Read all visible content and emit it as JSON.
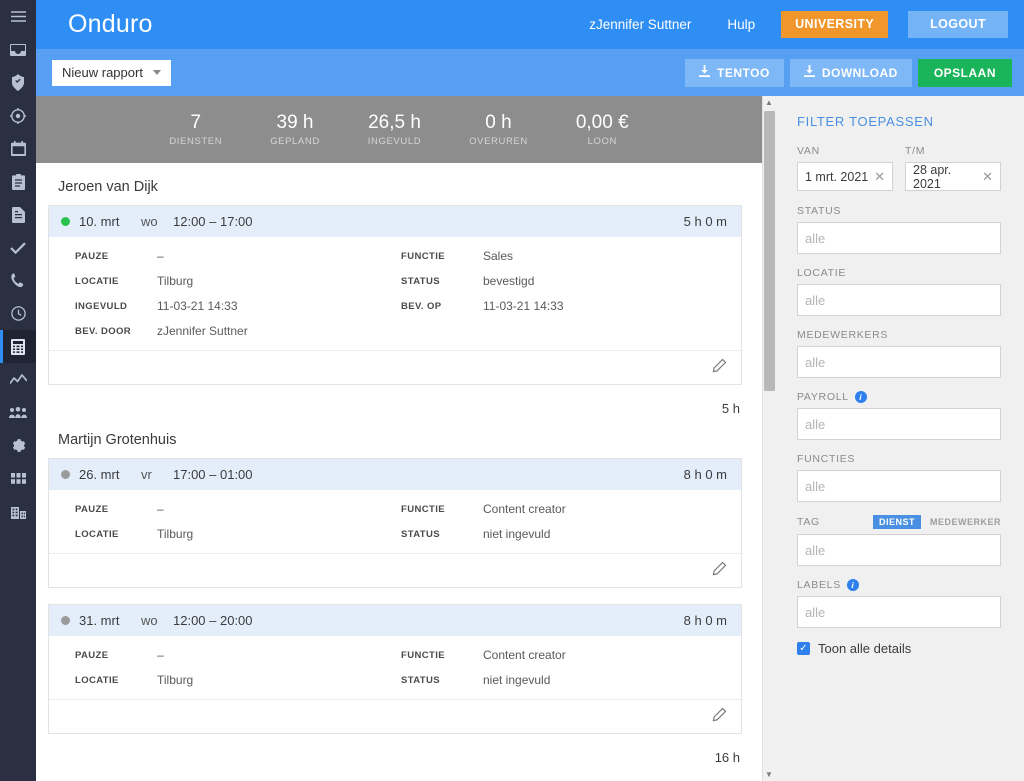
{
  "rail": {
    "items": [
      {
        "icon": "menu-icon",
        "name": "menu"
      },
      {
        "icon": "inbox-icon",
        "name": "inbox"
      },
      {
        "icon": "shield-check-icon",
        "name": "availability"
      },
      {
        "icon": "target-icon",
        "name": "clock-in"
      },
      {
        "icon": "calendar-icon",
        "name": "schedule"
      },
      {
        "icon": "clipboard-icon",
        "name": "tasks"
      },
      {
        "icon": "document-icon",
        "name": "documents"
      },
      {
        "icon": "check-icon",
        "name": "approvals"
      },
      {
        "icon": "phone-icon",
        "name": "contacts"
      },
      {
        "icon": "clock-icon",
        "name": "timeclock"
      },
      {
        "icon": "calculator-icon",
        "name": "reports",
        "active": true
      },
      {
        "icon": "chart-line-icon",
        "name": "analytics"
      },
      {
        "icon": "people-icon",
        "name": "employees"
      },
      {
        "icon": "gear-icon",
        "name": "settings"
      },
      {
        "icon": "grid-icon",
        "name": "apps"
      },
      {
        "icon": "building-icon",
        "name": "organisation"
      }
    ]
  },
  "header": {
    "brand": "Onduro",
    "user": "zJennifer Suttner",
    "help": "Hulp",
    "university": "UNIVERSITY",
    "logout": "LOGOUT"
  },
  "toolbar": {
    "report_select": "Nieuw rapport",
    "tentoo": "TENTOO",
    "download": "DOWNLOAD",
    "save": "OPSLAAN"
  },
  "stats": [
    {
      "value": "7",
      "label": "DIENSTEN"
    },
    {
      "value": "39 h",
      "label": "GEPLAND"
    },
    {
      "value": "26,5 h",
      "label": "INGEVULD"
    },
    {
      "value": "0 h",
      "label": "OVERUREN"
    },
    {
      "value": "0,00 €",
      "label": "LOON"
    }
  ],
  "employees": [
    {
      "name": "Jeroen van Dijk",
      "subtotal": "5 h",
      "shifts": [
        {
          "dot": "#27c24c",
          "date": "10. mrt",
          "day": "wo",
          "time": "12:00  –  17:00",
          "duration": "5 h 0 m",
          "details": [
            {
              "key": "PAUZE",
              "value": "–"
            },
            {
              "key": "FUNCTIE",
              "value": "Sales"
            },
            {
              "key": "LOCATIE",
              "value": "Tilburg"
            },
            {
              "key": "STATUS",
              "value": "bevestigd"
            },
            {
              "key": "INGEVULD",
              "value": "11-03-21 14:33"
            },
            {
              "key": "BEV. OP",
              "value": "11-03-21 14:33"
            },
            {
              "key": "BEV. DOOR",
              "value": "zJennifer Suttner"
            },
            {
              "key": "",
              "value": ""
            }
          ]
        }
      ]
    },
    {
      "name": "Martijn Grotenhuis",
      "subtotal": "16 h",
      "shifts": [
        {
          "dot": "#9b9b9b",
          "date": "26. mrt",
          "day": "vr",
          "time": "17:00  –  01:00",
          "duration": "8 h 0 m",
          "details": [
            {
              "key": "PAUZE",
              "value": "–"
            },
            {
              "key": "FUNCTIE",
              "value": "Content creator"
            },
            {
              "key": "LOCATIE",
              "value": "Tilburg"
            },
            {
              "key": "STATUS",
              "value": "niet ingevuld"
            }
          ]
        },
        {
          "dot": "#9b9b9b",
          "date": "31. mrt",
          "day": "wo",
          "time": "12:00  –  20:00",
          "duration": "8 h 0 m",
          "details": [
            {
              "key": "PAUZE",
              "value": "–"
            },
            {
              "key": "FUNCTIE",
              "value": "Content creator"
            },
            {
              "key": "LOCATIE",
              "value": "Tilburg"
            },
            {
              "key": "STATUS",
              "value": "niet ingevuld"
            }
          ]
        }
      ]
    }
  ],
  "filter": {
    "title": "FILTER TOEPASSEN",
    "van_label": "VAN",
    "van_value": "1 mrt. 2021",
    "tm_label": "T/M",
    "tm_value": "28 apr. 2021",
    "status_label": "STATUS",
    "status_placeholder": "alle",
    "locatie_label": "LOCATIE",
    "locatie_placeholder": "alle",
    "medewerkers_label": "MEDEWERKERS",
    "medewerkers_placeholder": "alle",
    "payroll_label": "PAYROLL",
    "payroll_placeholder": "alle",
    "functies_label": "FUNCTIES",
    "functies_placeholder": "alle",
    "tag_label": "TAG",
    "tag_toggle_on": "DIENST",
    "tag_toggle_off": "MEDEWERKER",
    "tag_placeholder": "alle",
    "labels_label": "LABELS",
    "labels_placeholder": "alle",
    "details_checkbox": "Toon alle details"
  }
}
